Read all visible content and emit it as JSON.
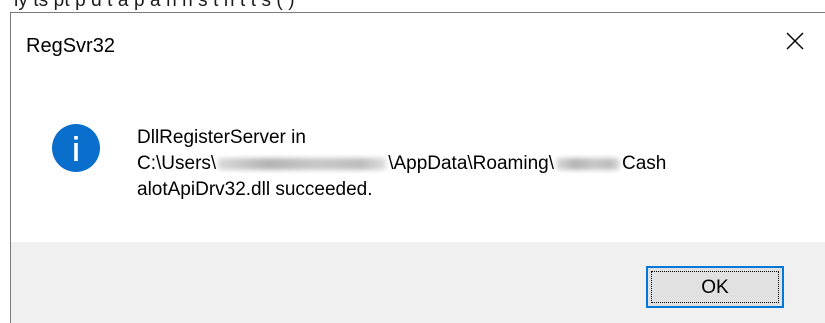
{
  "background": {
    "partial_text": "ly    ts    pt    p    d    t    a    p    a    n     n    s    t    n    t    t    s    (    )"
  },
  "dialog": {
    "title": "RegSvr32",
    "close_icon": "close-icon",
    "info_icon": "info-icon",
    "message": {
      "line1": "DllRegisterServer in",
      "line2_prefix": "C:\\Users\\",
      "line2_middle": "\\AppData\\Roaming\\",
      "line2_suffix": "Cash",
      "line3": "alotApiDrv32.dll succeeded."
    },
    "ok_label": "OK"
  },
  "colors": {
    "accent": "#0078d7",
    "footer_bg": "#f0f0f0",
    "button_bg": "#e1e1e1"
  }
}
